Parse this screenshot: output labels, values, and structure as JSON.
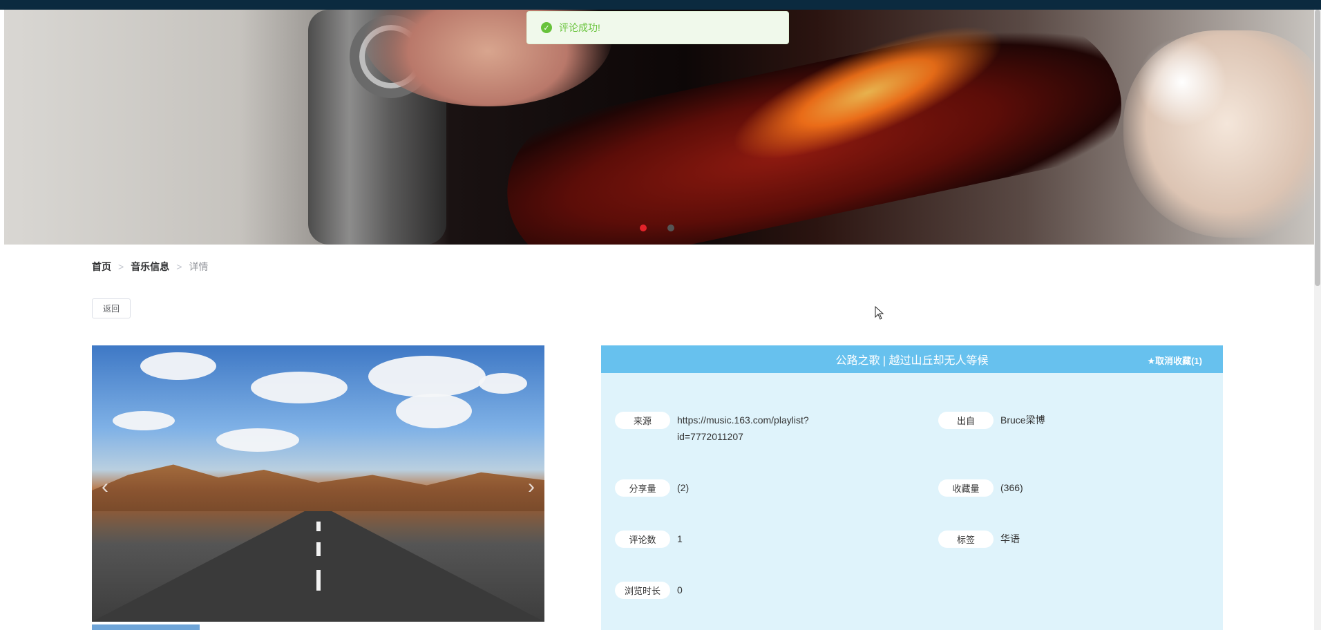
{
  "toast": {
    "message": "评论成功!"
  },
  "breadcrumb": {
    "home": "首页",
    "parent": "音乐信息",
    "current": "详情",
    "separator": ">"
  },
  "back_button": "返回",
  "detail": {
    "title": "公路之歌 | 越过山丘却无人等候",
    "fav_label": "★取消收藏(1)",
    "fields": {
      "source_label": "来源",
      "source_line1": "https://music.163.com/playlist?",
      "source_line2": "id=7772011207",
      "from_label": "出自",
      "from_value": "Bruce梁博",
      "share_label": "分享量",
      "share_value": "(2)",
      "collect_label": "收藏量",
      "collect_value": "(366)",
      "comments_label": "评论数",
      "comments_value": "1",
      "tag_label": "标签",
      "tag_value": "华语",
      "browse_label": "浏览时长",
      "browse_value": "0"
    }
  },
  "carousel": {
    "prev": "‹",
    "next": "›"
  },
  "colors": {
    "header": "#67c1ee",
    "card_bg": "#dff3fb",
    "success": "#67c23a",
    "active_dot": "#e2232a"
  }
}
